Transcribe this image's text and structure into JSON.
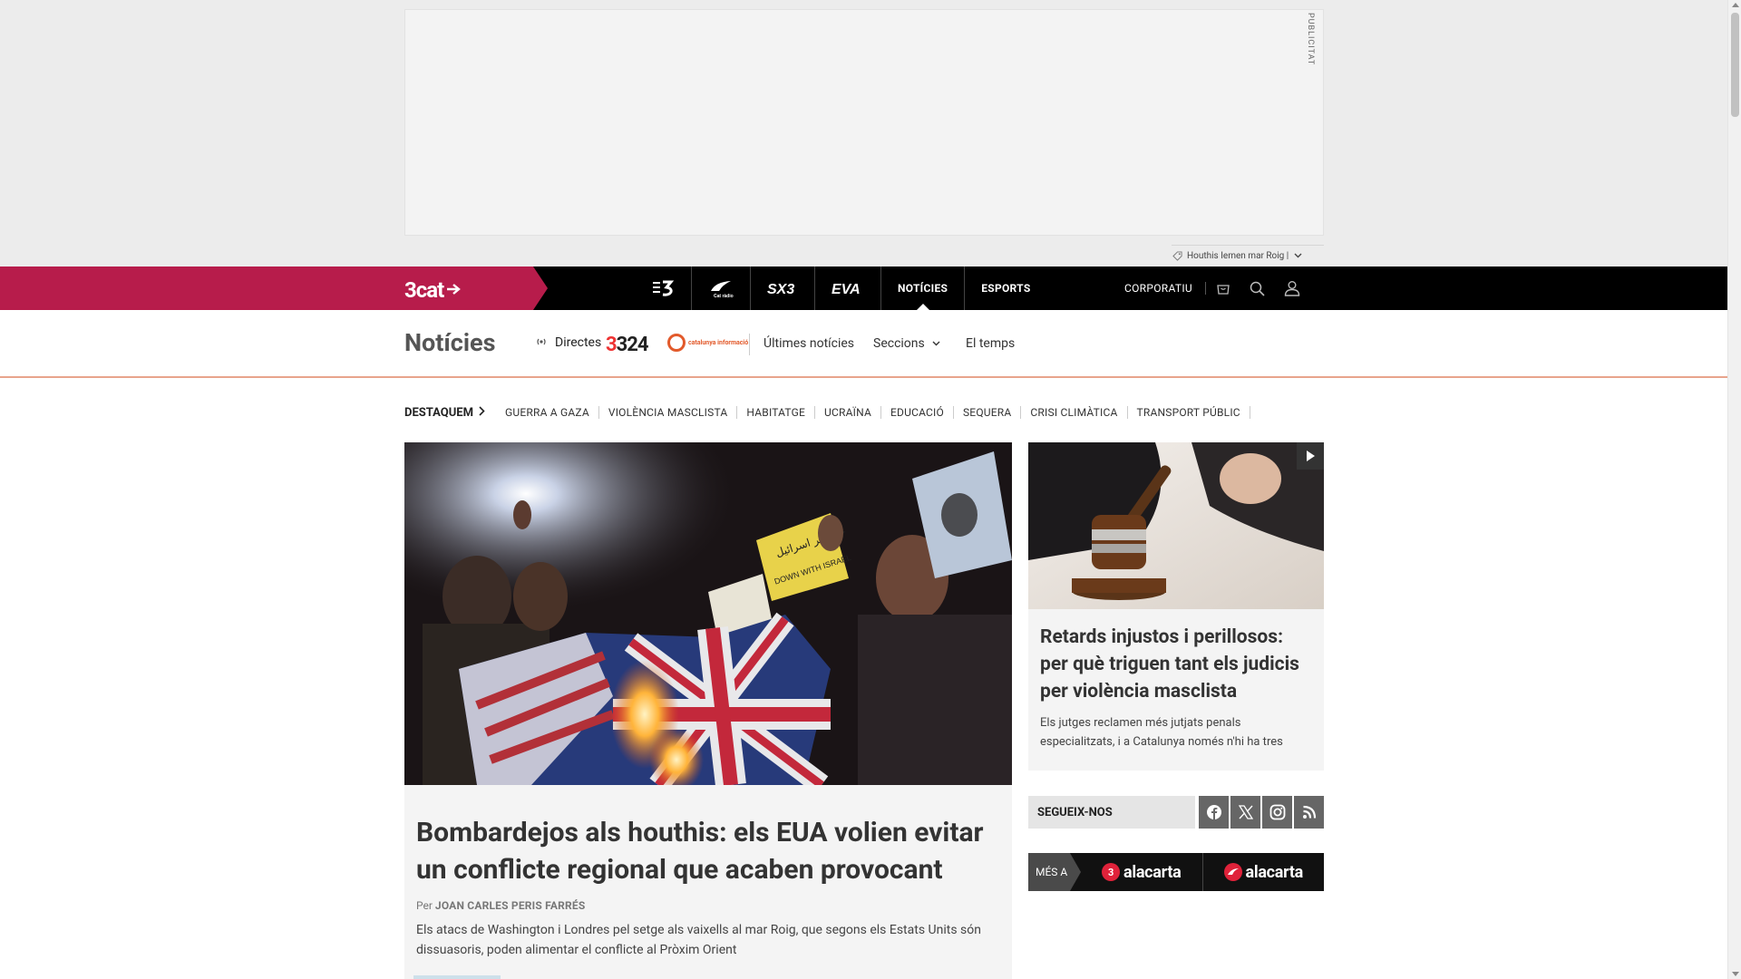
{
  "ad": {
    "label": "PUBLICITAT"
  },
  "tag_bar": {
    "text": "Houthis Iemen mar Roig |",
    "icon": "tag-icon"
  },
  "topnav": {
    "brand": "3cat",
    "channels": [
      {
        "label": "3",
        "name": "tv3-logo"
      },
      {
        "label": "Cat",
        "name": "catradio-logo"
      },
      {
        "label": "SX3",
        "name": "sx3-logo"
      },
      {
        "label": "EVA",
        "name": "eva-logo"
      },
      {
        "label": "NOTÍCIES",
        "name": "noticies"
      },
      {
        "label": "ESPORTS",
        "name": "esports"
      }
    ],
    "corporatiu": "CORPORATIU"
  },
  "section": {
    "title": "Notícies",
    "directes": "Directes",
    "logo324": "324",
    "catinfo": "catalunya informació",
    "links": {
      "ultimes": "Últimes notícies",
      "seccions": "Seccions",
      "temps": "El temps"
    }
  },
  "highlights": {
    "title": "DESTAQUEM",
    "items": [
      "GUERRA A GAZA",
      "VIOLÈNCIA MASCLISTA",
      "HABITATGE",
      "UCRAÏNA",
      "EDUCACIÓ",
      "SEQUERA",
      "CRISI CLIMÀTICA",
      "TRANSPORT PÚBLIC"
    ]
  },
  "main_story": {
    "headline": "Bombardejos als houthis: els EUA volien evitar un conflicte regional que acaben provocant",
    "by": "Per",
    "author": "JOAN CARLES PERIS FARRÉS",
    "lead": "Els atacs de Washington i Londres pel setge als vaixells al mar Roig, que segons els Estats Units són dissuasoris, poden alimentar el conflicte al Pròxim Orient",
    "sign_left": "حرق بر اسرائيل",
    "sign_right": "DOWN WITH ISRAEL"
  },
  "side_story": {
    "headline": "Retards injustos i perillosos: per què triguen tant els judicis per violència masclista",
    "lead": "Els jutges reclamen més jutjats penals especialitzats, i a Catalunya només n'hi ha tres"
  },
  "follow": {
    "label": "SEGUEIX-NOS"
  },
  "alacarta": {
    "mes_a": "MÉS A",
    "brand": "alacarta"
  }
}
